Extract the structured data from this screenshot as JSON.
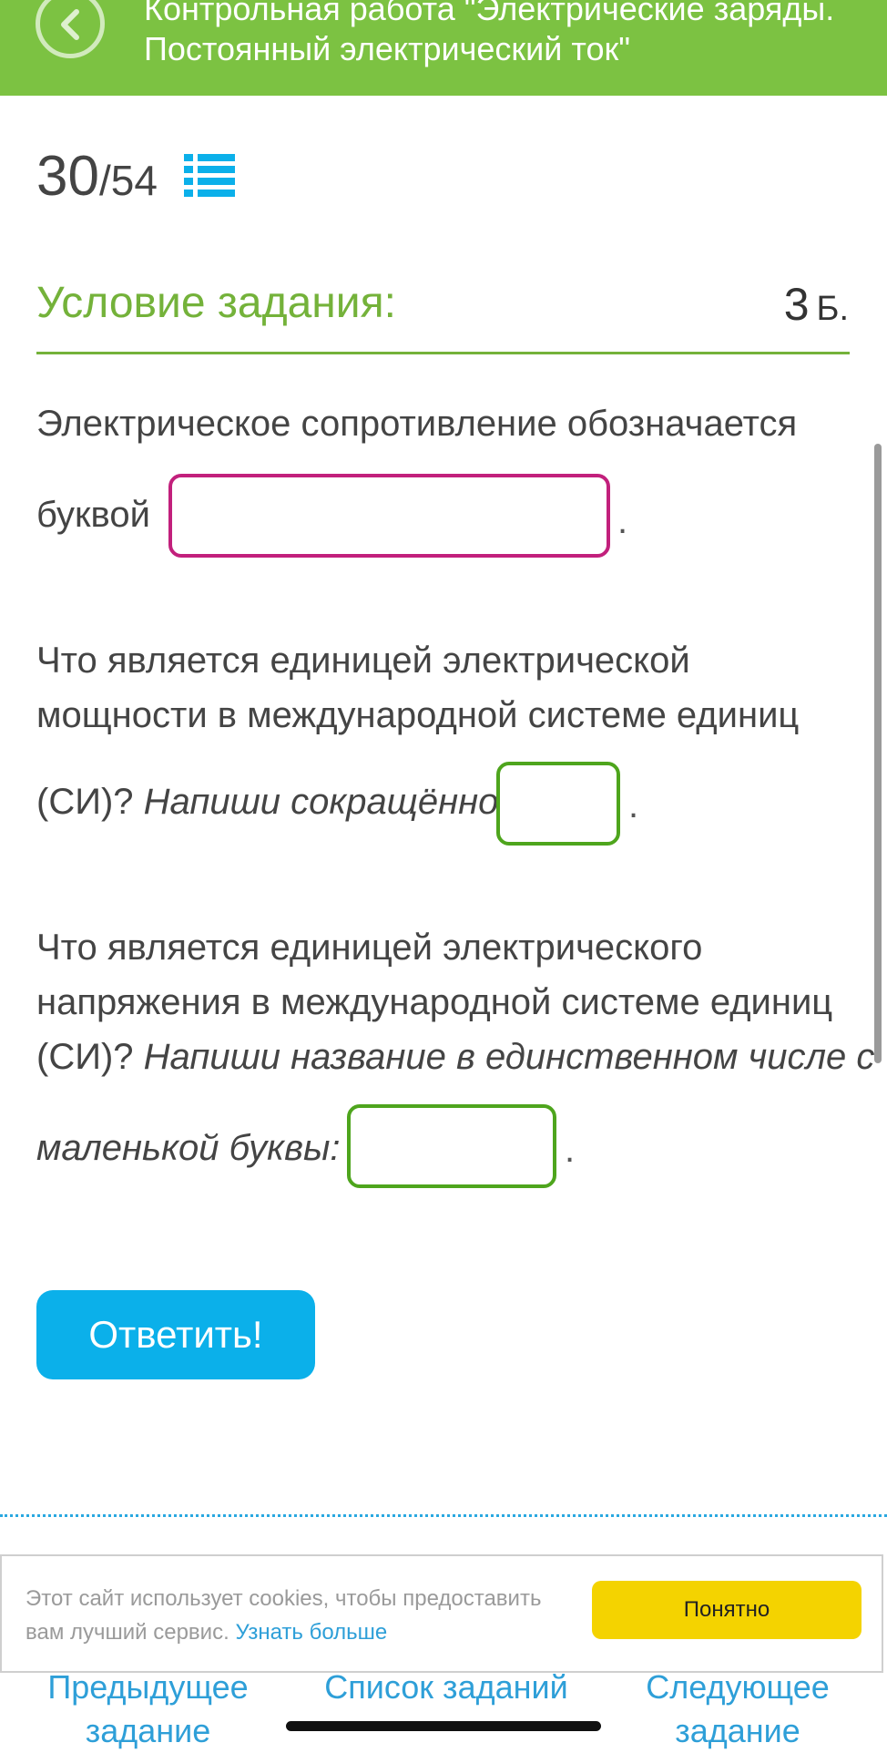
{
  "header": {
    "back_icon": "chevron-left-icon",
    "title_line1": "Контрольная работа \"Электрические заряды.",
    "title_line2": "Постоянный электрический ток\""
  },
  "progress": {
    "current": "30",
    "total": "/54",
    "list_icon": "list-icon"
  },
  "task": {
    "title": "Условие задания:",
    "points": "3",
    "points_unit": "Б."
  },
  "questions": {
    "q1_line1": "Электрическое сопротивление обозначается",
    "q1_line2": "буквой",
    "q1_input": "",
    "q2_line1": "Что является единицей электрической",
    "q2_line2": "мощности в международной системе единиц",
    "q2_line3": "(СИ)?",
    "q2_hint": "Напиши сокращённо:",
    "q2_input": "",
    "q3_line1": "Что является единицей электрического",
    "q3_line2": "напряжения в международной системе единиц",
    "q3_line3": "(СИ)?",
    "q3_hint_1": "Напиши название в единственном числе с",
    "q3_hint_2": "маленькой буквы:",
    "q3_input": "",
    "period": "."
  },
  "answer_button": "Ответить!",
  "cookie": {
    "text_1": "Этот сайт использует cookies, чтобы предоставить",
    "text_2": "вам лучший сервис.",
    "link": "Узнать больше",
    "ok": "Понятно"
  },
  "footer": {
    "prev_1": "Предыдущее",
    "prev_2": "задание",
    "list": "Список заданий",
    "next_1": "Следующее",
    "next_2": "задание"
  },
  "colors": {
    "green": "#7cc242",
    "blue": "#0bb0ea",
    "pink": "#c2207c",
    "yellow": "#f4d300"
  }
}
